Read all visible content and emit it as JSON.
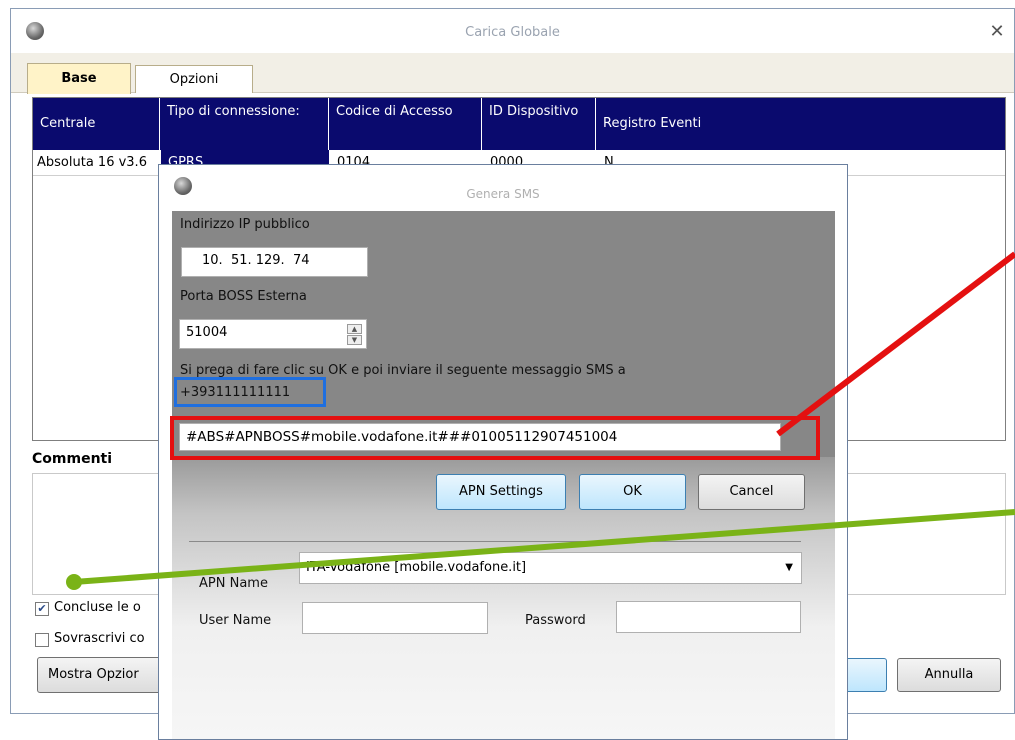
{
  "main_window": {
    "title": "Carica Globale",
    "close_glyph": "✕",
    "tabs": [
      {
        "label": "Base",
        "active": true
      },
      {
        "label": "Opzioni",
        "active": false
      }
    ],
    "grid": {
      "columns": [
        "Centrale",
        "Tipo di connessione:",
        "Codice di Accesso",
        "ID Dispositivo",
        "Registro Eventi"
      ],
      "row": [
        "Absoluta 16 v3.6",
        "GPRS",
        "0104",
        "0000",
        "N"
      ]
    },
    "comments_label": "Commenti",
    "checkbox_concluse": {
      "label": "Concluse le o",
      "checked": true
    },
    "checkbox_sovrascrivi": {
      "label": "Sovrascrivi co",
      "checked": false
    },
    "mostra_opzioni_label": "Mostra Opzior",
    "annulla_label": "Annulla"
  },
  "dialog": {
    "title": "Genera SMS",
    "ip_label": "Indirizzo IP pubblico",
    "ip_value": "10.  51. 129.  74",
    "port_label": "Porta BOSS Esterna",
    "port_value": "51004",
    "instruction_text": "Si prega di fare clic su OK e poi inviare il seguente messaggio SMS a",
    "phone_number": "+393111111111",
    "sms_text": "#ABS#APNBOSS#mobile.vodafone.it###01005112907451004",
    "buttons": {
      "apn_settings": "APN Settings",
      "ok": "OK",
      "cancel": "Cancel"
    },
    "apn_name_label": "APN Name",
    "apn_name_value": "ITA-Vodafone [mobile.vodafone.it]",
    "user_name_label": "User Name",
    "user_name_value": "",
    "password_label": "Password",
    "password_value": ""
  },
  "annotations": {
    "phone_highlight_color": "#1f6fe0",
    "sms_highlight_color": "#e41010",
    "arrow_red_color": "#e41010",
    "arrow_green_color": "#7ab317"
  }
}
